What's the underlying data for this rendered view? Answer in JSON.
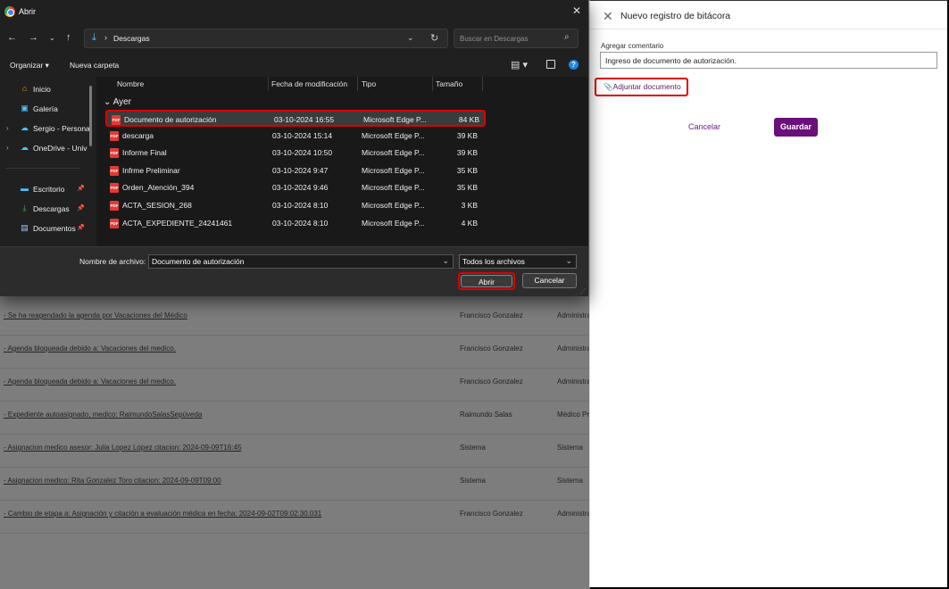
{
  "background": {
    "rows": [
      {
        "desc": "- Se ha reagendado la agenda por Vacaciones del Médico",
        "user": "Francisco Gonzalez",
        "role": "Administra"
      },
      {
        "desc": "- Agenda bloqueada debido a: Vacaciones del medico.",
        "user": "Francisco Gonzalez",
        "role": "Administra"
      },
      {
        "desc": "- Agenda bloqueada debido a: Vacaciones del medico.",
        "user": "Francisco Gonzalez",
        "role": "Administra"
      },
      {
        "desc": "- Expediente autoasignado, medico: RaimundoSalasSepúveda",
        "user": "Raimundo Salas",
        "role": "Médico Pre"
      },
      {
        "desc": "- Asignacion medico asesor: Julia Lopez Lopez citacion: 2024-09-09T16:45",
        "user": "Sistema",
        "role": "Sistema"
      },
      {
        "desc": "- Asignacion medico: Rita Gonzalez Toro citacion: 2024-09-09T09:00",
        "user": "Sistema",
        "role": "Sistema"
      },
      {
        "desc": "- Cambio de etapa a: Asignación y citación a evaluación médica en fecha: 2024-09-02T09:02:30.031",
        "user": "Francisco Gonzalez",
        "role": "Administra"
      }
    ]
  },
  "panel": {
    "title": "Nuevo registro de bitácora",
    "comment_label": "Agregar comentario",
    "comment_value": "Ingreso de documento de autorización.",
    "attach_label": "Adjuntar documento",
    "cancel_label": "Cancelar",
    "save_label": "Guardar",
    "accent_color": "#6b0f7a"
  },
  "dialog": {
    "title": "Abrir",
    "address_path": "Descargas",
    "search_placeholder": "Buscar en Descargas",
    "organize_label": "Organizar ▾",
    "new_folder_label": "Nueva carpeta",
    "nav_items": [
      {
        "label": "Inicio",
        "icon": "home-icon",
        "expandable": false,
        "pinned": false
      },
      {
        "label": "Galería",
        "icon": "gallery-icon",
        "expandable": false,
        "pinned": false
      },
      {
        "label": "Sergio - Persona",
        "icon": "cloud-icon",
        "expandable": true,
        "pinned": false
      },
      {
        "label": "OneDrive - Univ",
        "icon": "cloud-icon",
        "expandable": true,
        "pinned": false
      },
      {
        "label": "Escritorio",
        "icon": "desktop-icon",
        "expandable": false,
        "pinned": true
      },
      {
        "label": "Descargas",
        "icon": "download-icon",
        "expandable": false,
        "pinned": true
      },
      {
        "label": "Documentos",
        "icon": "documents-icon",
        "expandable": false,
        "pinned": true
      }
    ],
    "columns": [
      "Nombre",
      "Fecha de modificación",
      "Tipo",
      "Tamaño"
    ],
    "group_label": "Ayer",
    "files": [
      {
        "name": "Documento de autorización",
        "date": "03-10-2024 16:55",
        "type": "Microsoft Edge P...",
        "size": "84 KB",
        "selected": true
      },
      {
        "name": "descarga",
        "date": "03-10-2024 15:14",
        "type": "Microsoft Edge P...",
        "size": "39 KB",
        "selected": false
      },
      {
        "name": "Informe Final",
        "date": "03-10-2024 10:50",
        "type": "Microsoft Edge P...",
        "size": "39 KB",
        "selected": false
      },
      {
        "name": "Infrme Preliminar",
        "date": "03-10-2024 9:47",
        "type": "Microsoft Edge P...",
        "size": "35 KB",
        "selected": false
      },
      {
        "name": "Orden_Atención_394",
        "date": "03-10-2024 9:46",
        "type": "Microsoft Edge P...",
        "size": "35 KB",
        "selected": false
      },
      {
        "name": "ACTA_SESION_268",
        "date": "03-10-2024 8:10",
        "type": "Microsoft Edge P...",
        "size": "3 KB",
        "selected": false
      },
      {
        "name": "ACTA_EXPEDIENTE_24241461",
        "date": "03-10-2024 8:10",
        "type": "Microsoft Edge P...",
        "size": "4 KB",
        "selected": false
      }
    ],
    "filename_label": "Nombre de archivo:",
    "filename_value": "Documento de autorización",
    "filetype_value": "Todos los archivos",
    "open_label": "Abrir",
    "cancel_label": "Cancelar"
  }
}
